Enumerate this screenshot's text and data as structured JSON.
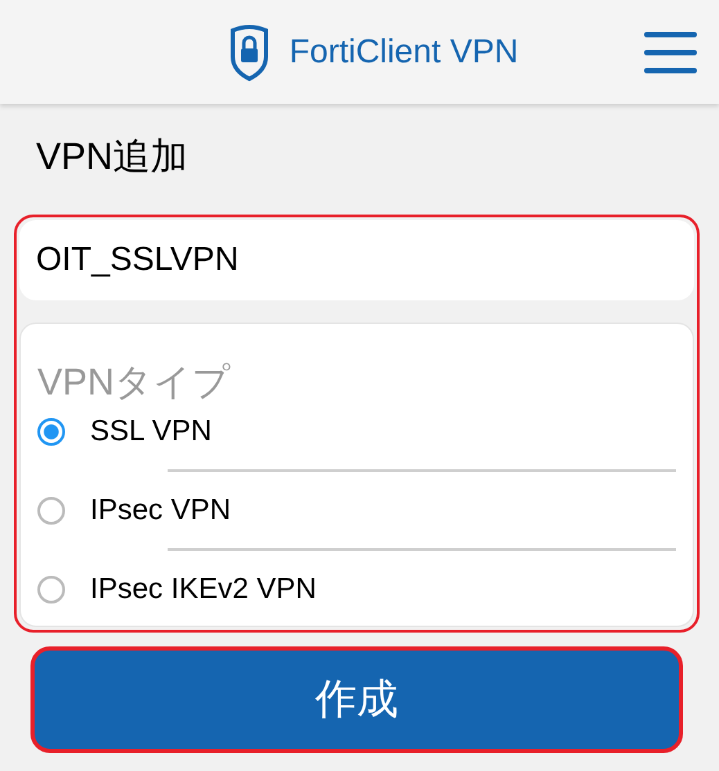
{
  "header": {
    "title": "FortiClient VPN"
  },
  "page_title": "VPN追加",
  "name_field": {
    "value": "OIT_SSLVPN"
  },
  "vpn_type": {
    "label": "VPNタイプ",
    "options": [
      {
        "label": "SSL VPN",
        "selected": true
      },
      {
        "label": "IPsec VPN",
        "selected": false
      },
      {
        "label": "IPsec IKEv2 VPN",
        "selected": false
      }
    ]
  },
  "create_button": {
    "label": "作成"
  }
}
